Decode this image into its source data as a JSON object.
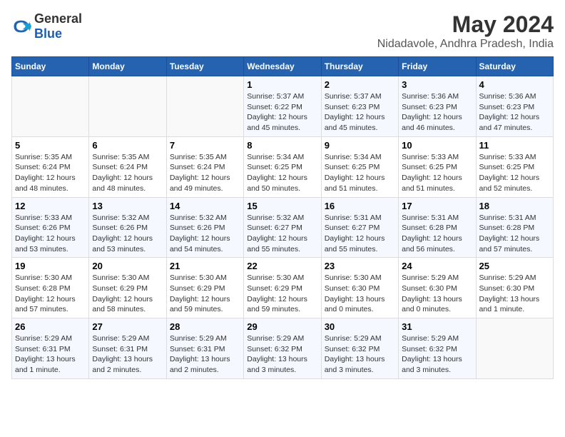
{
  "logo": {
    "general": "General",
    "blue": "Blue"
  },
  "title": "May 2024",
  "subtitle": "Nidadavole, Andhra Pradesh, India",
  "weekdays": [
    "Sunday",
    "Monday",
    "Tuesday",
    "Wednesday",
    "Thursday",
    "Friday",
    "Saturday"
  ],
  "weeks": [
    [
      {
        "day": "",
        "info": ""
      },
      {
        "day": "",
        "info": ""
      },
      {
        "day": "",
        "info": ""
      },
      {
        "day": "1",
        "info": "Sunrise: 5:37 AM\nSunset: 6:22 PM\nDaylight: 12 hours\nand 45 minutes."
      },
      {
        "day": "2",
        "info": "Sunrise: 5:37 AM\nSunset: 6:23 PM\nDaylight: 12 hours\nand 45 minutes."
      },
      {
        "day": "3",
        "info": "Sunrise: 5:36 AM\nSunset: 6:23 PM\nDaylight: 12 hours\nand 46 minutes."
      },
      {
        "day": "4",
        "info": "Sunrise: 5:36 AM\nSunset: 6:23 PM\nDaylight: 12 hours\nand 47 minutes."
      }
    ],
    [
      {
        "day": "5",
        "info": "Sunrise: 5:35 AM\nSunset: 6:24 PM\nDaylight: 12 hours\nand 48 minutes."
      },
      {
        "day": "6",
        "info": "Sunrise: 5:35 AM\nSunset: 6:24 PM\nDaylight: 12 hours\nand 48 minutes."
      },
      {
        "day": "7",
        "info": "Sunrise: 5:35 AM\nSunset: 6:24 PM\nDaylight: 12 hours\nand 49 minutes."
      },
      {
        "day": "8",
        "info": "Sunrise: 5:34 AM\nSunset: 6:25 PM\nDaylight: 12 hours\nand 50 minutes."
      },
      {
        "day": "9",
        "info": "Sunrise: 5:34 AM\nSunset: 6:25 PM\nDaylight: 12 hours\nand 51 minutes."
      },
      {
        "day": "10",
        "info": "Sunrise: 5:33 AM\nSunset: 6:25 PM\nDaylight: 12 hours\nand 51 minutes."
      },
      {
        "day": "11",
        "info": "Sunrise: 5:33 AM\nSunset: 6:25 PM\nDaylight: 12 hours\nand 52 minutes."
      }
    ],
    [
      {
        "day": "12",
        "info": "Sunrise: 5:33 AM\nSunset: 6:26 PM\nDaylight: 12 hours\nand 53 minutes."
      },
      {
        "day": "13",
        "info": "Sunrise: 5:32 AM\nSunset: 6:26 PM\nDaylight: 12 hours\nand 53 minutes."
      },
      {
        "day": "14",
        "info": "Sunrise: 5:32 AM\nSunset: 6:26 PM\nDaylight: 12 hours\nand 54 minutes."
      },
      {
        "day": "15",
        "info": "Sunrise: 5:32 AM\nSunset: 6:27 PM\nDaylight: 12 hours\nand 55 minutes."
      },
      {
        "day": "16",
        "info": "Sunrise: 5:31 AM\nSunset: 6:27 PM\nDaylight: 12 hours\nand 55 minutes."
      },
      {
        "day": "17",
        "info": "Sunrise: 5:31 AM\nSunset: 6:28 PM\nDaylight: 12 hours\nand 56 minutes."
      },
      {
        "day": "18",
        "info": "Sunrise: 5:31 AM\nSunset: 6:28 PM\nDaylight: 12 hours\nand 57 minutes."
      }
    ],
    [
      {
        "day": "19",
        "info": "Sunrise: 5:30 AM\nSunset: 6:28 PM\nDaylight: 12 hours\nand 57 minutes."
      },
      {
        "day": "20",
        "info": "Sunrise: 5:30 AM\nSunset: 6:29 PM\nDaylight: 12 hours\nand 58 minutes."
      },
      {
        "day": "21",
        "info": "Sunrise: 5:30 AM\nSunset: 6:29 PM\nDaylight: 12 hours\nand 59 minutes."
      },
      {
        "day": "22",
        "info": "Sunrise: 5:30 AM\nSunset: 6:29 PM\nDaylight: 12 hours\nand 59 minutes."
      },
      {
        "day": "23",
        "info": "Sunrise: 5:30 AM\nSunset: 6:30 PM\nDaylight: 13 hours\nand 0 minutes."
      },
      {
        "day": "24",
        "info": "Sunrise: 5:29 AM\nSunset: 6:30 PM\nDaylight: 13 hours\nand 0 minutes."
      },
      {
        "day": "25",
        "info": "Sunrise: 5:29 AM\nSunset: 6:30 PM\nDaylight: 13 hours\nand 1 minute."
      }
    ],
    [
      {
        "day": "26",
        "info": "Sunrise: 5:29 AM\nSunset: 6:31 PM\nDaylight: 13 hours\nand 1 minute."
      },
      {
        "day": "27",
        "info": "Sunrise: 5:29 AM\nSunset: 6:31 PM\nDaylight: 13 hours\nand 2 minutes."
      },
      {
        "day": "28",
        "info": "Sunrise: 5:29 AM\nSunset: 6:31 PM\nDaylight: 13 hours\nand 2 minutes."
      },
      {
        "day": "29",
        "info": "Sunrise: 5:29 AM\nSunset: 6:32 PM\nDaylight: 13 hours\nand 3 minutes."
      },
      {
        "day": "30",
        "info": "Sunrise: 5:29 AM\nSunset: 6:32 PM\nDaylight: 13 hours\nand 3 minutes."
      },
      {
        "day": "31",
        "info": "Sunrise: 5:29 AM\nSunset: 6:32 PM\nDaylight: 13 hours\nand 3 minutes."
      },
      {
        "day": "",
        "info": ""
      }
    ]
  ]
}
